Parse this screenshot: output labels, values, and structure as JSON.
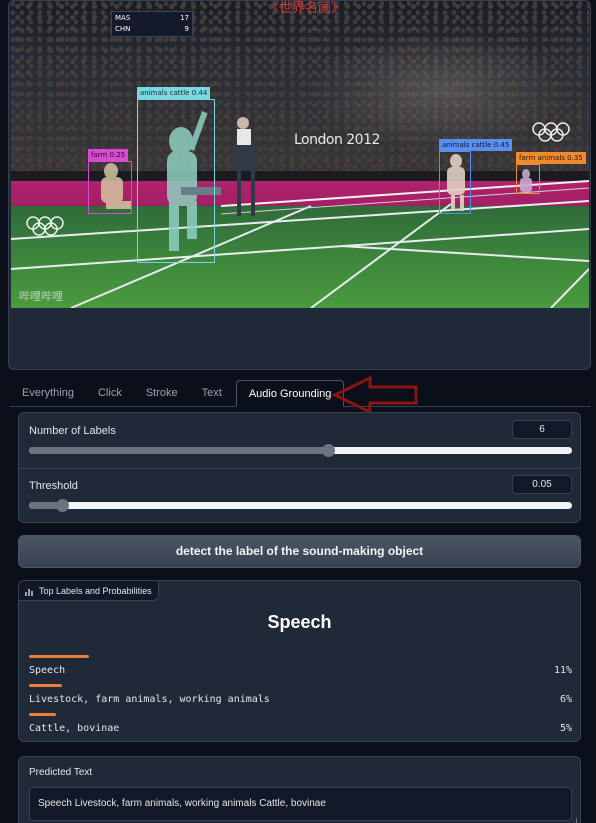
{
  "image": {
    "score_team1": "MAS",
    "score_team1_vals": "17",
    "score_team2": "CHN",
    "score_team2_vals": "9",
    "title_overlay": "《世界名画》",
    "court_text": "London 2012",
    "watermark": "哔哩哔哩",
    "detections": [
      {
        "label": "animals cattle 0.44",
        "color": "#7ad8e0"
      },
      {
        "label": "farm 0.25",
        "color": "#d84ad0"
      },
      {
        "label": "animals cattle 0.45",
        "color": "#5a8ff0"
      },
      {
        "label": "farm animals 0.35",
        "color": "#f08a30"
      }
    ]
  },
  "tabs": [
    {
      "label": "Everything"
    },
    {
      "label": "Click"
    },
    {
      "label": "Stroke"
    },
    {
      "label": "Text"
    },
    {
      "label": "Audio Grounding",
      "active": true
    }
  ],
  "controls": {
    "num_labels": {
      "label": "Number of Labels",
      "value": "6",
      "fraction": 0.55
    },
    "threshold": {
      "label": "Threshold",
      "value": "0.05",
      "fraction": 0.06
    }
  },
  "detect_button": "detect the label of the sound-making object",
  "labels_panel": {
    "tag": "Top Labels and Probabilities",
    "top_label": "Speech",
    "confidences": [
      {
        "label": "Speech",
        "pct": "11%",
        "value": 0.11
      },
      {
        "label": "Livestock, farm animals, working animals",
        "pct": "6%",
        "value": 0.06
      },
      {
        "label": "Cattle, bovinae",
        "pct": "5%",
        "value": 0.05
      }
    ]
  },
  "predicted": {
    "label": "Predicted Text",
    "value": "Speech Livestock, farm animals, working animals Cattle, bovinae"
  },
  "colors": {
    "accent_arrow": "#8b1414",
    "confidence_bar": "#ea7e3a"
  }
}
